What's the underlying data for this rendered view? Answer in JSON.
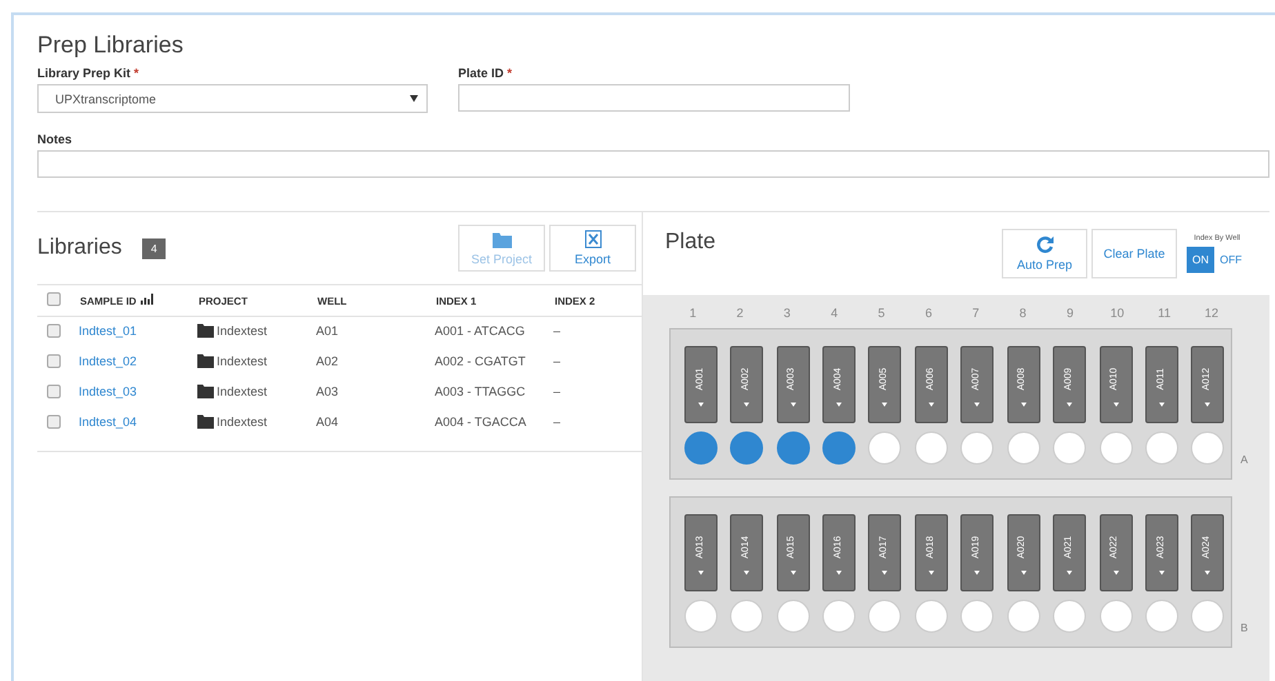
{
  "title": "Prep Libraries",
  "kit_field": {
    "label": "Library Prep Kit",
    "required_mark": "*",
    "value": "UPXtranscriptome"
  },
  "plate_id_field": {
    "label": "Plate ID",
    "required_mark": "*"
  },
  "notes_field": {
    "label": "Notes"
  },
  "libraries": {
    "title": "Libraries",
    "count": "4",
    "buttons": [
      {
        "label": "Set Project",
        "kind": "folder",
        "disabled": true
      },
      {
        "label": "Export",
        "kind": "excel",
        "disabled": false
      }
    ],
    "select_all_checked": false,
    "columns": [
      "SAMPLE ID",
      "PROJECT",
      "WELL",
      "INDEX 1",
      "INDEX 2"
    ],
    "rows": [
      {
        "checked": false,
        "sample": "Indtest_01",
        "project": "Indextest",
        "well": "A01",
        "index1": "A001 - ATCACG",
        "index2": "–"
      },
      {
        "checked": false,
        "sample": "Indtest_02",
        "project": "Indextest",
        "well": "A02",
        "index1": "A002 - CGATGT",
        "index2": "–"
      },
      {
        "checked": false,
        "sample": "Indtest_03",
        "project": "Indextest",
        "well": "A03",
        "index1": "A003 - TTAGGC",
        "index2": "–"
      },
      {
        "checked": false,
        "sample": "Indtest_04",
        "project": "Indextest",
        "well": "A04",
        "index1": "A004 - TGACCA",
        "index2": "–"
      }
    ]
  },
  "plate": {
    "title": "Plate",
    "buttons": [
      {
        "label": "Auto Prep",
        "kind": "refresh"
      },
      {
        "label": "Clear Plate",
        "kind": "plain"
      }
    ],
    "index_by_well": {
      "label": "Index By Well",
      "options": [
        {
          "label": "ON",
          "selected": true
        },
        {
          "label": "OFF",
          "selected": false
        }
      ]
    },
    "columns": [
      "1",
      "2",
      "3",
      "4",
      "5",
      "6",
      "7",
      "8",
      "9",
      "10",
      "11",
      "12"
    ],
    "rows": [
      {
        "label": "A",
        "wells": [
          {
            "tube": "A001",
            "filled": true
          },
          {
            "tube": "A002",
            "filled": true
          },
          {
            "tube": "A003",
            "filled": true
          },
          {
            "tube": "A004",
            "filled": true
          },
          {
            "tube": "A005",
            "filled": false
          },
          {
            "tube": "A006",
            "filled": false
          },
          {
            "tube": "A007",
            "filled": false
          },
          {
            "tube": "A008",
            "filled": false
          },
          {
            "tube": "A009",
            "filled": false
          },
          {
            "tube": "A010",
            "filled": false
          },
          {
            "tube": "A011",
            "filled": false
          },
          {
            "tube": "A012",
            "filled": false
          }
        ]
      },
      {
        "label": "B",
        "wells": [
          {
            "tube": "A013",
            "filled": false
          },
          {
            "tube": "A014",
            "filled": false
          },
          {
            "tube": "A015",
            "filled": false
          },
          {
            "tube": "A016",
            "filled": false
          },
          {
            "tube": "A017",
            "filled": false
          },
          {
            "tube": "A018",
            "filled": false
          },
          {
            "tube": "A019",
            "filled": false
          },
          {
            "tube": "A020",
            "filled": false
          },
          {
            "tube": "A021",
            "filled": false
          },
          {
            "tube": "A022",
            "filled": false
          },
          {
            "tube": "A023",
            "filled": false
          },
          {
            "tube": "A024",
            "filled": false
          }
        ]
      }
    ]
  }
}
